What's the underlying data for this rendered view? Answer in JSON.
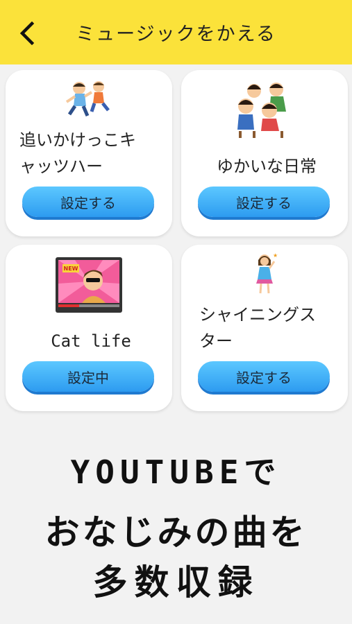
{
  "header": {
    "title": "ミュージックをかえる",
    "back_icon": "chevron-left-icon",
    "background": "#fbe23a"
  },
  "tracks": [
    {
      "name_line1": "追いかけっこキ",
      "name_line2": "ャッツハー",
      "button": "設定する"
    },
    {
      "name_line1": "ゆかいな日常",
      "button": "設定する"
    },
    {
      "name_line1": "Cat life",
      "button": "設定中"
    },
    {
      "name_line1": "シャイニングス",
      "name_line2": "ター",
      "button": "設定する"
    }
  ],
  "promo": {
    "line1": "YOUTUBEで",
    "line2": "おなじみの曲を",
    "line3": "多数収録"
  },
  "colors": {
    "button": "#3aa8f5",
    "card": "#ffffff",
    "page": "#f2f2f2"
  }
}
